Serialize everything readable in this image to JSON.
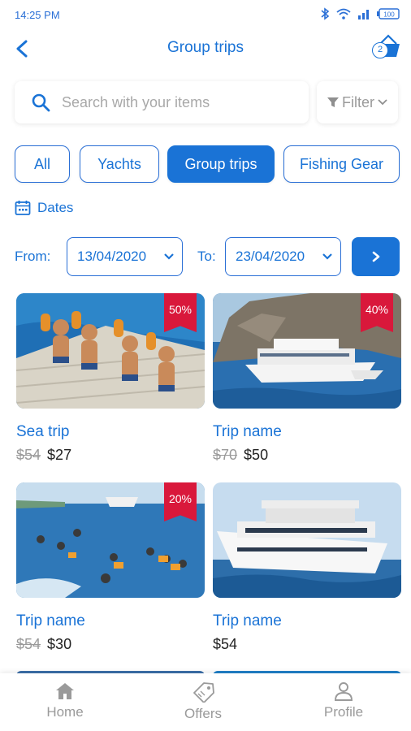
{
  "status_bar": {
    "time": "14:25 PM",
    "battery": "100",
    "icons": [
      "bluetooth-icon",
      "wifi-icon",
      "signal-icon",
      "battery-icon"
    ]
  },
  "header": {
    "title": "Group trips",
    "cart_count": "2"
  },
  "search": {
    "placeholder": "Search with your items",
    "value": ""
  },
  "filter": {
    "label": "Filter"
  },
  "categories": [
    {
      "label": "All",
      "active": false
    },
    {
      "label": "Yachts",
      "active": false
    },
    {
      "label": "Group trips",
      "active": true
    },
    {
      "label": "Fishing Gear",
      "active": false
    }
  ],
  "dates": {
    "label": "Dates",
    "from_label": "From:",
    "from_value": "13/04/2020",
    "to_label": "To:",
    "to_value": "23/04/2020"
  },
  "items": [
    {
      "title": "Sea trip",
      "old_price": "$54",
      "price": "$27",
      "discount": "50%"
    },
    {
      "title": "Trip name",
      "old_price": "$70",
      "price": "$50",
      "discount": "40%"
    },
    {
      "title": "Trip name",
      "old_price": "$54",
      "price": "$30",
      "discount": "20%"
    },
    {
      "title": "Trip name",
      "old_price": "",
      "price": "$54",
      "discount": ""
    }
  ],
  "nav": [
    {
      "label": "Home",
      "icon": "home-icon"
    },
    {
      "label": "Offers",
      "icon": "offers-tag-icon"
    },
    {
      "label": "Profile",
      "icon": "profile-icon"
    }
  ],
  "colors": {
    "primary": "#1a73d6",
    "ribbon": "#d9183b",
    "muted": "#9a9a9a"
  }
}
